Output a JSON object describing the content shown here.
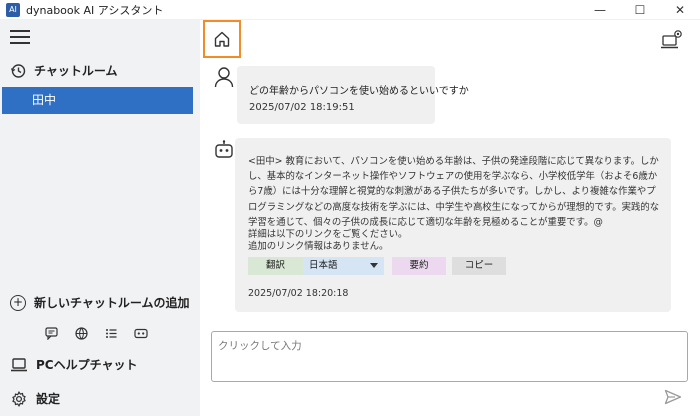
{
  "window": {
    "title": "dynabook AI アシスタント",
    "app_icon_text": "AI",
    "minimize": "—",
    "maximize": "☐",
    "close": "✕"
  },
  "sidebar": {
    "chat_rooms_label": "チャットルーム",
    "rooms": [
      {
        "label": "田中",
        "selected": true
      }
    ],
    "add_room_label": "新しいチャットルームの追加",
    "pc_help_label": "PCヘルプチャット",
    "settings_label": "設定"
  },
  "messages": [
    {
      "role": "user",
      "text": "どの年齢からパソコンを使い始めるといいですか",
      "time": "2025/07/02 18:19:51"
    },
    {
      "role": "assistant",
      "text": "<田中> 教育において、パソコンを使い始める年齢は、子供の発達段階に応じて異なります。しかし、基本的なインターネット操作やソフトウェアの使用を学ぶなら、小学校低学年（およそ6歳から7歳）には十分な理解と視覚的な刺激がある子供たちが多いです。しかし、より複雑な作業やプログラミングなどの高度な技術を学ぶには、中学生や高校生になってからが理想的です。実践的な学習を通じて、個々の子供の成長に応じて適切な年齢を見極めることが重要です。@",
      "detail_line1": "詳細は以下のリンクをご覧ください。",
      "detail_line2": "追加のリンク情報はありません。",
      "time": "2025/07/02 18:20:18",
      "actions": {
        "translate": "翻訳",
        "language": "日本語",
        "summary": "要約",
        "copy": "コピー"
      }
    }
  ],
  "input": {
    "placeholder": "クリックして入力",
    "value": ""
  },
  "colors": {
    "accent_selected": "#2f6fc4",
    "home_highlight": "#f28c28",
    "translate_bg": "#d9e8d5",
    "language_bg": "#d6e5f4",
    "summary_bg": "#ecd9f0",
    "copy_bg": "#dedede"
  }
}
